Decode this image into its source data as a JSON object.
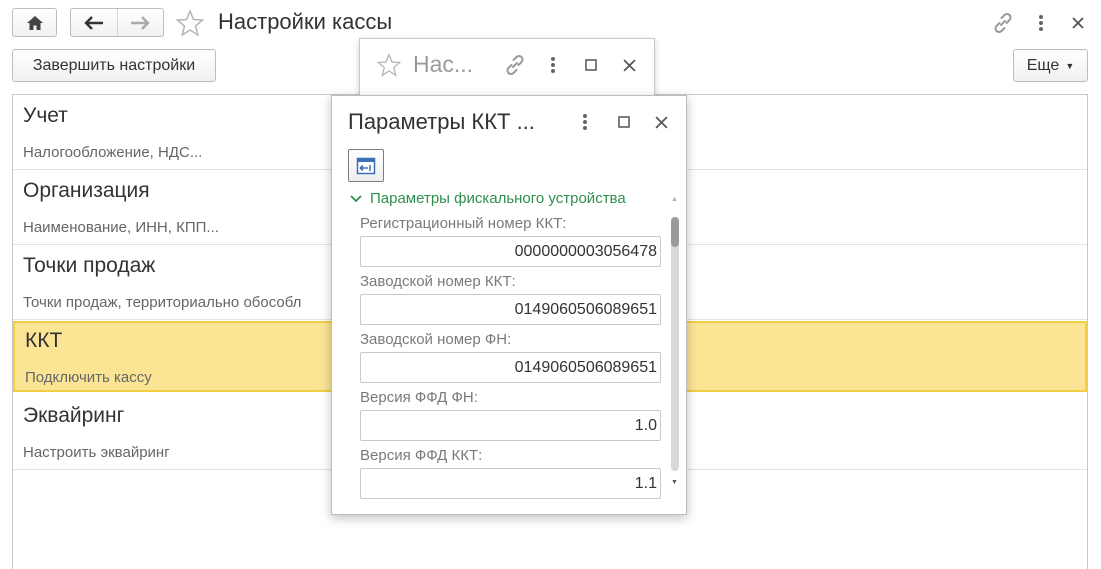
{
  "header": {
    "title": "Настройки кассы",
    "finish_button": "Завершить настройки",
    "more_button": "Еще",
    "icons": [
      "home-icon",
      "back-arrow-icon",
      "forward-arrow-icon",
      "star-icon",
      "link-icon",
      "more-vertical-icon",
      "close-icon"
    ]
  },
  "sections": [
    {
      "title": "Учет",
      "subtitle": "Налогообложение, НДС..."
    },
    {
      "title": "Организация",
      "subtitle": "Наименование, ИНН, КПП..."
    },
    {
      "title": "Точки продаж",
      "subtitle": "Точки продаж, территориально обособл"
    },
    {
      "title": "ККТ",
      "subtitle": "Подключить кассу",
      "selected": true
    },
    {
      "title": "Эквайринг",
      "subtitle": "Настроить эквайринг"
    }
  ],
  "background_window": {
    "title": "Нас..."
  },
  "dialog": {
    "title": "Параметры ККТ ...",
    "group_title": "Параметры фискального устройства",
    "fields": [
      {
        "label": "Регистрационный номер ККТ:",
        "value": "0000000003056478"
      },
      {
        "label": "Заводской номер ККТ:",
        "value": "0149060506089651"
      },
      {
        "label": "Заводской номер ФН:",
        "value": "0149060506089651"
      },
      {
        "label": "Версия ФФД ФН:",
        "value": "1.0"
      },
      {
        "label": "Версия ФФД ККТ:",
        "value": "1.1"
      }
    ]
  },
  "colors": {
    "selected_background": "#fbe595",
    "selected_border": "#f0cf47",
    "group_title": "#2f8f4e"
  }
}
